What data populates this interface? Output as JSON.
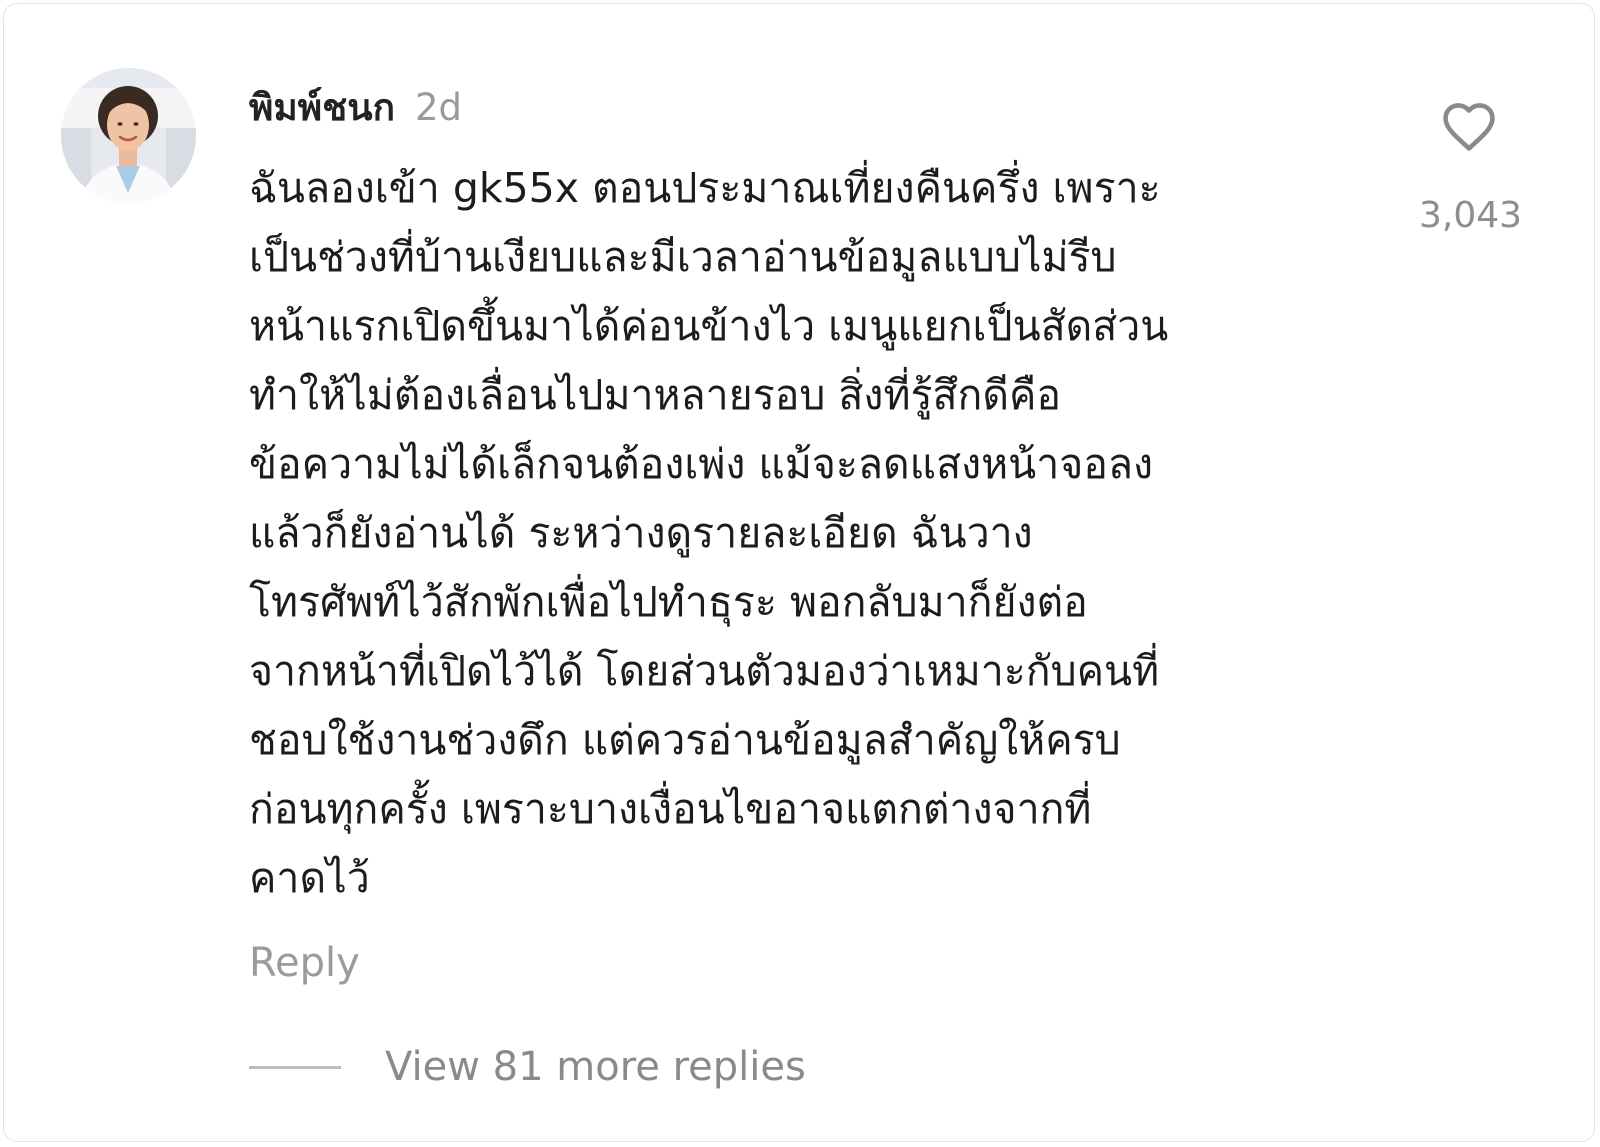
{
  "comment": {
    "username": "พิมพ์ชนก",
    "timestamp": "2d",
    "text_lines": [
      "ฉันลองเข้า gk55x ตอนประมาณเที่ยงคืนครึ่ง เพราะ",
      "เป็นช่วงที่บ้านเงียบและมีเวลาอ่านข้อมูลแบบไม่รีบ",
      "หน้าแรกเปิดขึ้นมาได้ค่อนข้างไว เมนูแยกเป็นสัดส่วน",
      "ทำให้ไม่ต้องเลื่อนไปมาหลายรอบ สิ่งที่รู้สึกดีคือ",
      "ข้อความไม่ได้เล็กจนต้องเพ่ง แม้จะลดแสงหน้าจอลง",
      "แล้วก็ยังอ่านได้ ระหว่างดูรายละเอียด ฉันวาง",
      "โทรศัพท์ไว้สักพักเพื่อไปทำธุระ พอกลับมาก็ยังต่อ",
      "จากหน้าที่เปิดไว้ได้ โดยส่วนตัวมองว่าเหมาะกับคนที่",
      "ชอบใช้งานช่วงดึก แต่ควรอ่านข้อมูลสำคัญให้ครบ",
      "ก่อนทุกครั้ง เพราะบางเงื่อนไขอาจแตกต่างจากที่",
      "คาดไว้"
    ],
    "like_count": "3,043",
    "reply_label": "Reply",
    "view_more_label": "View 81 more replies"
  },
  "icons": {
    "like": "heart-outline-icon",
    "avatar": "user-photo"
  },
  "colors": {
    "text": "#1c1c1c",
    "muted": "#9b9b9b",
    "heart": "#8a8a8a"
  }
}
